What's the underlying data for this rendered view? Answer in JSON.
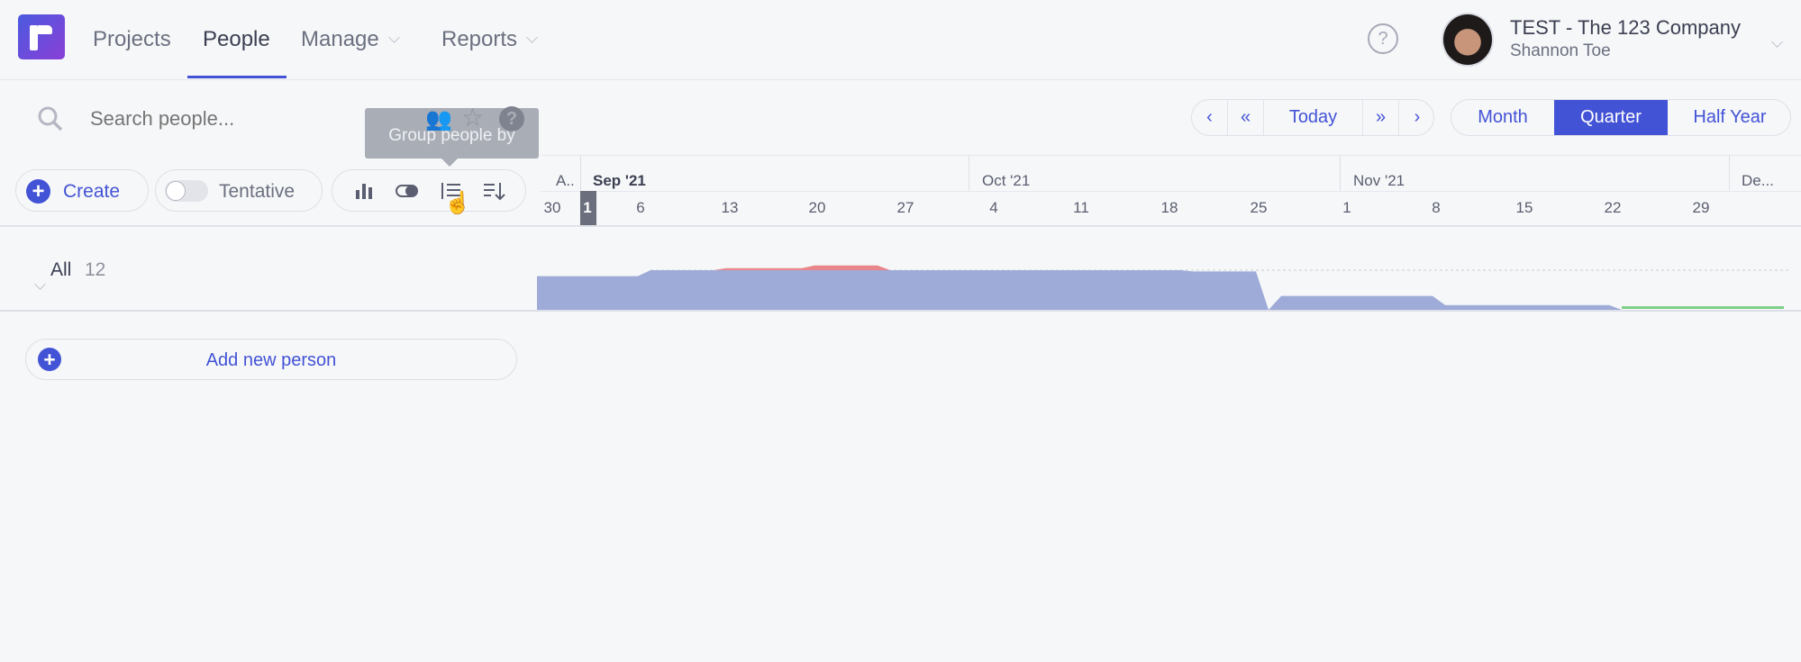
{
  "header": {
    "nav": [
      {
        "label": "Projects"
      },
      {
        "label": "People",
        "active": true
      },
      {
        "label": "Manage",
        "dropdown": true
      },
      {
        "label": "Reports",
        "dropdown": true
      }
    ],
    "account": {
      "company": "TEST - The 123 Company",
      "user": "Shannon Toe"
    },
    "help_icon": "question-circle-icon"
  },
  "search": {
    "placeholder": "Search people...",
    "tooltip": "Group people by"
  },
  "date_nav": {
    "today_label": "Today",
    "views": [
      {
        "label": "Month"
      },
      {
        "label": "Quarter",
        "active": true
      },
      {
        "label": "Half Year"
      }
    ]
  },
  "toolbar": {
    "create_label": "Create",
    "tentative_label": "Tentative",
    "tentative_on": false,
    "icons": [
      "bar-chart-icon",
      "toggle-icon",
      "group-list-icon",
      "sort-icon"
    ]
  },
  "timeline": {
    "months": [
      "A..",
      "Sep '21",
      "Oct '21",
      "Nov '21",
      "De..."
    ],
    "days": [
      "30",
      "1",
      "6",
      "13",
      "20",
      "27",
      "4",
      "11",
      "18",
      "25",
      "1",
      "8",
      "15",
      "22",
      "29"
    ],
    "today": "1"
  },
  "group": {
    "label": "All",
    "count": "12"
  },
  "add_person_label": "Add new person",
  "colors": {
    "accent": "#4353d6",
    "scheduled": "#9eabd8",
    "overtime": "#e8868a",
    "available": "#7fd08a"
  },
  "chart_data": {
    "type": "area",
    "unit": "% of capacity",
    "scheduled": [
      [
        "2021-08-28",
        85
      ],
      [
        "2021-09-05",
        85
      ],
      [
        "2021-09-06",
        100
      ],
      [
        "2021-10-18",
        100
      ],
      [
        "2021-10-19",
        97
      ],
      [
        "2021-10-24",
        97
      ],
      [
        "2021-10-25",
        0
      ],
      [
        "2021-10-26",
        35
      ],
      [
        "2021-11-07",
        35
      ],
      [
        "2021-11-08",
        12
      ],
      [
        "2021-11-21",
        12
      ],
      [
        "2021-11-22",
        0
      ]
    ],
    "overtime": [
      [
        "2021-09-11",
        0
      ],
      [
        "2021-09-12",
        5
      ],
      [
        "2021-09-18",
        5
      ],
      [
        "2021-09-19",
        12
      ],
      [
        "2021-09-24",
        12
      ],
      [
        "2021-09-25",
        0
      ]
    ],
    "available": [
      [
        "2021-11-22",
        "2021-12-31"
      ]
    ]
  }
}
